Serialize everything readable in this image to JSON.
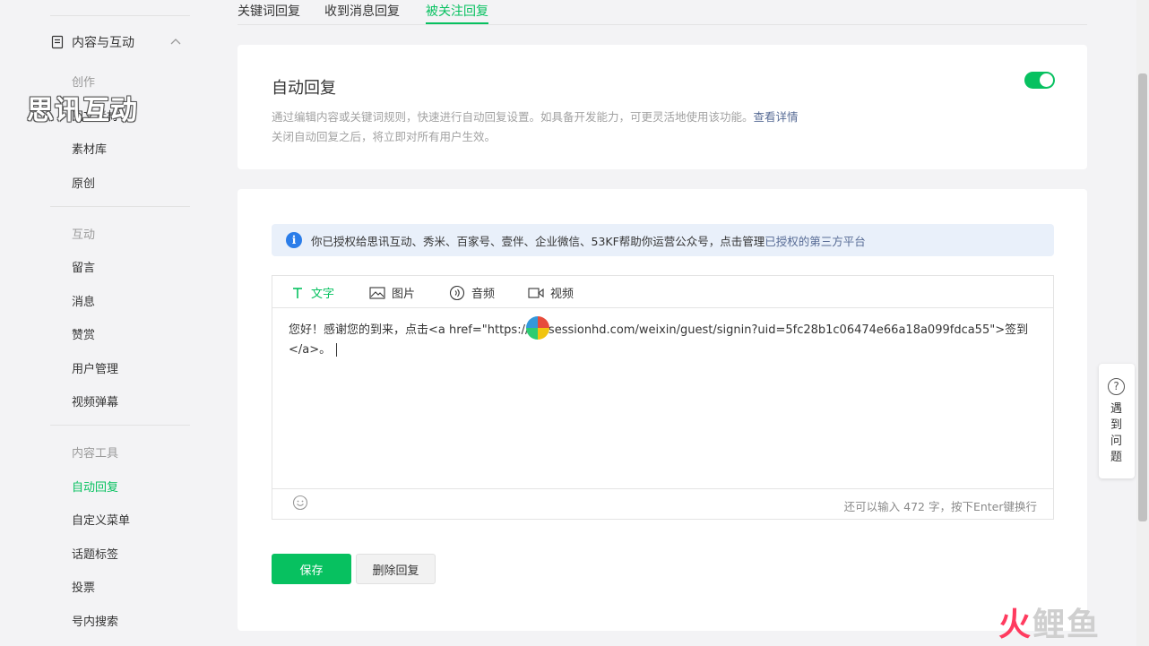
{
  "sidebar": {
    "section_label": "内容与互动",
    "groups": [
      {
        "title": "创作",
        "items": [
          "图文素材",
          "素材库",
          "原创"
        ]
      },
      {
        "title": "互动",
        "items": [
          "留言",
          "消息",
          "赞赏",
          "用户管理",
          "视频弹幕"
        ]
      },
      {
        "title": "内容工具",
        "items": [
          "自动回复",
          "自定义菜单",
          "话题标签",
          "投票",
          "号内搜索"
        ]
      }
    ],
    "active_item": "自动回复"
  },
  "watermark": "思讯互动",
  "tabs": [
    "关键词回复",
    "收到消息回复",
    "被关注回复"
  ],
  "active_tab": "被关注回复",
  "auto_reply": {
    "title": "自动回复",
    "desc_line1": "通过编辑内容或关键词规则，快速进行自动回复设置。如具备开发能力，可更灵活地使用该功能。",
    "desc_link": "查看详情",
    "desc_line2": "关闭自动回复之后，将立即对所有用户生效。",
    "enabled": true
  },
  "notice": {
    "text": "你已授权给思讯互动、秀米、百家号、壹伴、企业微信、53KF帮助你运营公众号，点击管理",
    "link": "已授权的第三方平台"
  },
  "editor": {
    "tabs": [
      "文字",
      "图片",
      "音频",
      "视频"
    ],
    "active_tab": "文字",
    "content": "您好！感谢您的到来，点击<a href=\"https://      nt.sessionhd.com/weixin/guest/signin?uid=5fc28b1c06474e66a18a099fdca55\">签到</a>。",
    "counter": "还可以输入 472 字，按下Enter键换行"
  },
  "buttons": {
    "save": "保存",
    "delete": "删除回复"
  },
  "help_label": "遇到问题",
  "corner_logo": {
    "part1": "火",
    "part2": "鲤鱼"
  },
  "colors": {
    "accent": "#07c160",
    "link": "#576b95",
    "info": "#2b7de9"
  }
}
